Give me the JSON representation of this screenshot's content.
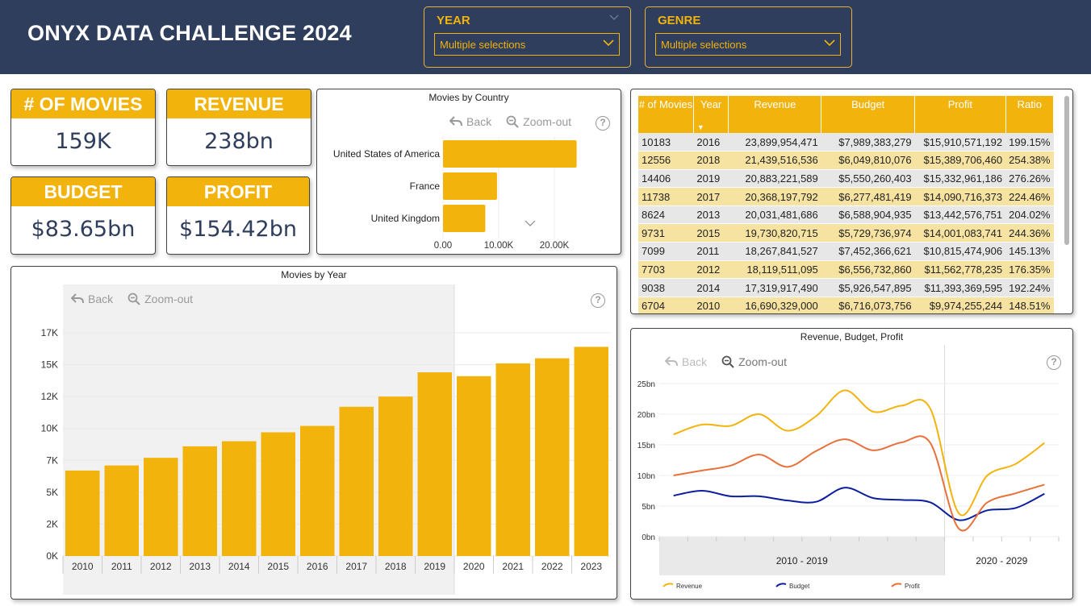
{
  "app": {
    "title": "ONYX DATA CHALLENGE 2024"
  },
  "slicers": [
    {
      "title": "YEAR",
      "value": "Multiple selections"
    },
    {
      "title": "GENRE",
      "value": "Multiple selections"
    }
  ],
  "kpis": [
    {
      "label": "# OF MOVIES",
      "value": "159K"
    },
    {
      "label": "REVENUE",
      "value": "238bn"
    },
    {
      "label": "BUDGET",
      "value": "$83.65bn"
    },
    {
      "label": "PROFIT",
      "value": "$154.42bn"
    }
  ],
  "toolbar": {
    "back": "Back",
    "zoom_out": "Zoom-out",
    "help": "?"
  },
  "table": {
    "columns": [
      "# of Movies",
      "Year",
      "Revenue",
      "Budget",
      "Profit",
      "Ratio"
    ],
    "rows": [
      [
        "10183",
        "2016",
        "23,899,954,471",
        "$7,989,383,279",
        "$15,910,571,192",
        "199.15%"
      ],
      [
        "12556",
        "2018",
        "21,439,516,536",
        "$6,049,810,076",
        "$15,389,706,460",
        "254.38%"
      ],
      [
        "14406",
        "2019",
        "20,883,221,589",
        "$5,550,260,403",
        "$15,332,961,186",
        "276.26%"
      ],
      [
        "11738",
        "2017",
        "20,368,197,792",
        "$6,277,481,419",
        "$14,090,716,373",
        "224.46%"
      ],
      [
        "8624",
        "2013",
        "20,031,481,686",
        "$6,588,904,935",
        "$13,442,576,751",
        "204.02%"
      ],
      [
        "9731",
        "2015",
        "19,730,820,715",
        "$5,729,736,974",
        "$14,001,083,741",
        "244.36%"
      ],
      [
        "7099",
        "2011",
        "18,267,841,527",
        "$7,452,366,621",
        "$10,815,474,906",
        "145.13%"
      ],
      [
        "7703",
        "2012",
        "18,119,511,095",
        "$6,556,732,860",
        "$11,562,778,235",
        "176.35%"
      ],
      [
        "9038",
        "2014",
        "17,319,917,490",
        "$5,926,547,895",
        "$11,393,369,595",
        "192.24%"
      ],
      [
        "6704",
        "2010",
        "16,690,329,000",
        "$6,716,073,756",
        "$9,974,255,244",
        "148.51%"
      ]
    ]
  },
  "chart_data": [
    {
      "type": "bar",
      "orientation": "horizontal",
      "title": "Movies by Country",
      "categories": [
        "United States of America",
        "France",
        "United Kingdom"
      ],
      "values": [
        24000,
        9700,
        7600
      ],
      "xlim": [
        0,
        30000
      ],
      "tick_labels": [
        "0.00",
        "10.00K",
        "20.00K"
      ],
      "ticks": [
        0,
        10000,
        20000
      ],
      "color": "#f2b30c"
    },
    {
      "type": "bar",
      "title": "Movies by Year",
      "categories": [
        "2010",
        "2011",
        "2012",
        "2013",
        "2014",
        "2015",
        "2016",
        "2017",
        "2018",
        "2019",
        "2020",
        "2021",
        "2022",
        "2023"
      ],
      "values": [
        6700,
        7100,
        7700,
        8600,
        9000,
        9700,
        10200,
        11700,
        12500,
        14400,
        14100,
        15100,
        15500,
        16400
      ],
      "ylim": [
        0,
        17500
      ],
      "tick_labels": [
        "0K",
        "2K",
        "5K",
        "7K",
        "10K",
        "12K",
        "15K",
        "17K"
      ],
      "ticks": [
        0,
        2500,
        5000,
        7500,
        10000,
        12500,
        15000,
        17500
      ],
      "color": "#f2b30c"
    },
    {
      "type": "line",
      "title": "Revenue, Budget, Profit",
      "x": [
        2010,
        2011,
        2012,
        2013,
        2014,
        2015,
        2016,
        2017,
        2018,
        2019,
        2020,
        2021,
        2022,
        2023
      ],
      "ylim": [
        0,
        25
      ],
      "tick_labels": [
        "0bn",
        "5bn",
        "10bn",
        "15bn",
        "20bn",
        "25bn"
      ],
      "ticks": [
        0,
        5,
        10,
        15,
        20,
        25
      ],
      "x_groups": [
        "2010 - 2019",
        "2020 - 2029"
      ],
      "series": [
        {
          "name": "Revenue",
          "color": "#f2b30c",
          "values": [
            16.7,
            18.3,
            18.1,
            20.0,
            17.3,
            19.7,
            23.9,
            20.4,
            21.4,
            20.9,
            3.8,
            10.0,
            11.9,
            15.3
          ]
        },
        {
          "name": "Budget",
          "color": "#0b1f9e",
          "values": [
            6.7,
            7.5,
            6.6,
            6.6,
            5.9,
            5.7,
            8.0,
            6.3,
            6.0,
            5.6,
            2.7,
            4.3,
            4.7,
            7.0
          ]
        },
        {
          "name": "Profit",
          "color": "#e8703a",
          "values": [
            10.0,
            10.8,
            11.6,
            13.4,
            11.4,
            14.0,
            15.9,
            14.1,
            15.4,
            15.3,
            1.3,
            5.6,
            7.1,
            8.5
          ]
        }
      ]
    }
  ]
}
